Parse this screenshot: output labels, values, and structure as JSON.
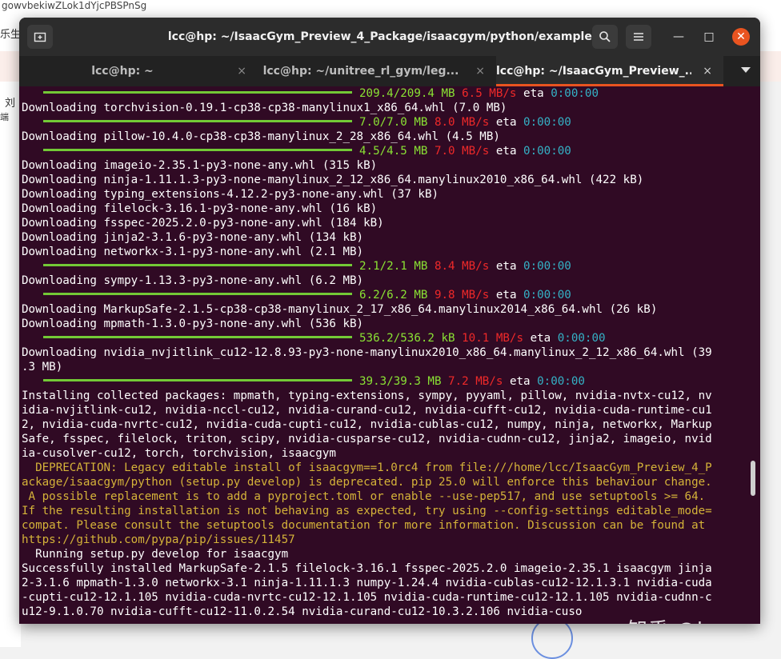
{
  "background": {
    "url_text": "gowvbekiwZLok1dYjcPBSPnSg",
    "fragments": [
      "乐生",
      "刘",
      "端"
    ]
  },
  "window": {
    "title": "lcc@hp: ~/IsaacGym_Preview_4_Package/isaacgym/python/examples",
    "new_tab_icon": "new-tab-icon",
    "search_icon": "search-icon",
    "menu_icon": "hamburger-menu-icon",
    "minimize_glyph": "—",
    "maximize_glyph": "□",
    "close_glyph": "✕",
    "accent": "#e95420"
  },
  "tabs": [
    {
      "label": "lcc@hp: ~",
      "close": "×"
    },
    {
      "label": "lcc@hp: ~/unitree_rl_gym/leg...",
      "close": "×"
    },
    {
      "label": "lcc@hp: ~/IsaacGym_Preview_...",
      "close": "×",
      "active": true
    }
  ],
  "colors": {
    "terminal_bg": "#300a24",
    "progress_green": "#73c936",
    "size_green": "#8ae234",
    "speed_red": "#ef2929",
    "eta_cyan": "#34b2c6",
    "deprecation_yellow": "#d5b339"
  },
  "terminal": {
    "lines": [
      {
        "type": "progress",
        "size": "209.4/209.4 MB",
        "speed": "6.5 MB/s",
        "eta_label": "eta",
        "eta": "0:00:00"
      },
      {
        "type": "text",
        "text": "Downloading torchvision-0.19.1-cp38-cp38-manylinux1_x86_64.whl (7.0 MB)"
      },
      {
        "type": "progress",
        "size": "7.0/7.0 MB",
        "speed": "8.0 MB/s",
        "eta_label": "eta",
        "eta": "0:00:00"
      },
      {
        "type": "text",
        "text": "Downloading pillow-10.4.0-cp38-cp38-manylinux_2_28_x86_64.whl (4.5 MB)"
      },
      {
        "type": "progress",
        "size": "4.5/4.5 MB",
        "speed": "7.0 MB/s",
        "eta_label": "eta",
        "eta": "0:00:00"
      },
      {
        "type": "text",
        "text": "Downloading imageio-2.35.1-py3-none-any.whl (315 kB)"
      },
      {
        "type": "text",
        "text": "Downloading ninja-1.11.1.3-py3-none-manylinux_2_12_x86_64.manylinux2010_x86_64.whl (422 kB)"
      },
      {
        "type": "text",
        "text": "Downloading typing_extensions-4.12.2-py3-none-any.whl (37 kB)"
      },
      {
        "type": "text",
        "text": "Downloading filelock-3.16.1-py3-none-any.whl (16 kB)"
      },
      {
        "type": "text",
        "text": "Downloading fsspec-2025.2.0-py3-none-any.whl (184 kB)"
      },
      {
        "type": "text",
        "text": "Downloading jinja2-3.1.6-py3-none-any.whl (134 kB)"
      },
      {
        "type": "text",
        "text": "Downloading networkx-3.1-py3-none-any.whl (2.1 MB)"
      },
      {
        "type": "progress",
        "size": "2.1/2.1 MB",
        "speed": "8.4 MB/s",
        "eta_label": "eta",
        "eta": "0:00:00"
      },
      {
        "type": "text",
        "text": "Downloading sympy-1.13.3-py3-none-any.whl (6.2 MB)"
      },
      {
        "type": "progress",
        "size": "6.2/6.2 MB",
        "speed": "9.8 MB/s",
        "eta_label": "eta",
        "eta": "0:00:00"
      },
      {
        "type": "text",
        "text": "Downloading MarkupSafe-2.1.5-cp38-cp38-manylinux_2_17_x86_64.manylinux2014_x86_64.whl (26 kB)"
      },
      {
        "type": "text",
        "text": "Downloading mpmath-1.3.0-py3-none-any.whl (536 kB)"
      },
      {
        "type": "progress",
        "size": "536.2/536.2 kB",
        "speed": "10.1 MB/s",
        "eta_label": "eta",
        "eta": "0:00:00"
      },
      {
        "type": "text",
        "text": "Downloading nvidia_nvjitlink_cu12-12.8.93-py3-none-manylinux2010_x86_64.manylinux_2_12_x86_64.whl (39"
      },
      {
        "type": "text",
        "text": ".3 MB)"
      },
      {
        "type": "progress",
        "size": "39.3/39.3 MB",
        "speed": "7.2 MB/s",
        "eta_label": "eta",
        "eta": "0:00:00"
      },
      {
        "type": "text",
        "text": "Installing collected packages: mpmath, typing-extensions, sympy, pyyaml, pillow, nvidia-nvtx-cu12, nv"
      },
      {
        "type": "text",
        "text": "idia-nvjitlink-cu12, nvidia-nccl-cu12, nvidia-curand-cu12, nvidia-cufft-cu12, nvidia-cuda-runtime-cu1"
      },
      {
        "type": "text",
        "text": "2, nvidia-cuda-nvrtc-cu12, nvidia-cuda-cupti-cu12, nvidia-cublas-cu12, numpy, ninja, networkx, Markup"
      },
      {
        "type": "text",
        "text": "Safe, fsspec, filelock, triton, scipy, nvidia-cusparse-cu12, nvidia-cudnn-cu12, jinja2, imageio, nvid"
      },
      {
        "type": "text",
        "text": "ia-cusolver-cu12, torch, torchvision, isaacgym"
      },
      {
        "type": "warn",
        "text": "  DEPRECATION: Legacy editable install of isaacgym==1.0rc4 from file:///home/lcc/IsaacGym_Preview_4_P"
      },
      {
        "type": "warn",
        "text": "ackage/isaacgym/python (setup.py develop) is deprecated. pip 25.0 will enforce this behaviour change."
      },
      {
        "type": "warn",
        "text": " A possible replacement is to add a pyproject.toml or enable --use-pep517, and use setuptools >= 64."
      },
      {
        "type": "warn",
        "text": "If the resulting installation is not behaving as expected, try using --config-settings editable_mode="
      },
      {
        "type": "warn",
        "text": "compat. Please consult the setuptools documentation for more information. Discussion can be found at"
      },
      {
        "type": "warn",
        "text": "https://github.com/pypa/pip/issues/11457"
      },
      {
        "type": "text",
        "text": "  Running setup.py develop for isaacgym"
      },
      {
        "type": "text",
        "text": "Successfully installed MarkupSafe-2.1.5 filelock-3.16.1 fsspec-2025.2.0 imageio-2.35.1 isaacgym jinja"
      },
      {
        "type": "text",
        "text": "2-3.1.6 mpmath-1.3.0 networkx-3.1 ninja-1.11.1.3 numpy-1.24.4 nvidia-cublas-cu12-12.1.3.1 nvidia-cuda"
      },
      {
        "type": "text",
        "text": "-cupti-cu12-12.1.105 nvidia-cuda-nvrtc-cu12-12.1.105 nvidia-cuda-runtime-cu12-12.1.105 nvidia-cudnn-c"
      },
      {
        "type": "text",
        "text": "u12-9.1.0.70 nvidia-cufft-cu12-11.0.2.54 nvidia-curand-cu12-10.3.2.106 nvidia-cuso"
      }
    ]
  },
  "watermark": "知乎 @lcccccc"
}
